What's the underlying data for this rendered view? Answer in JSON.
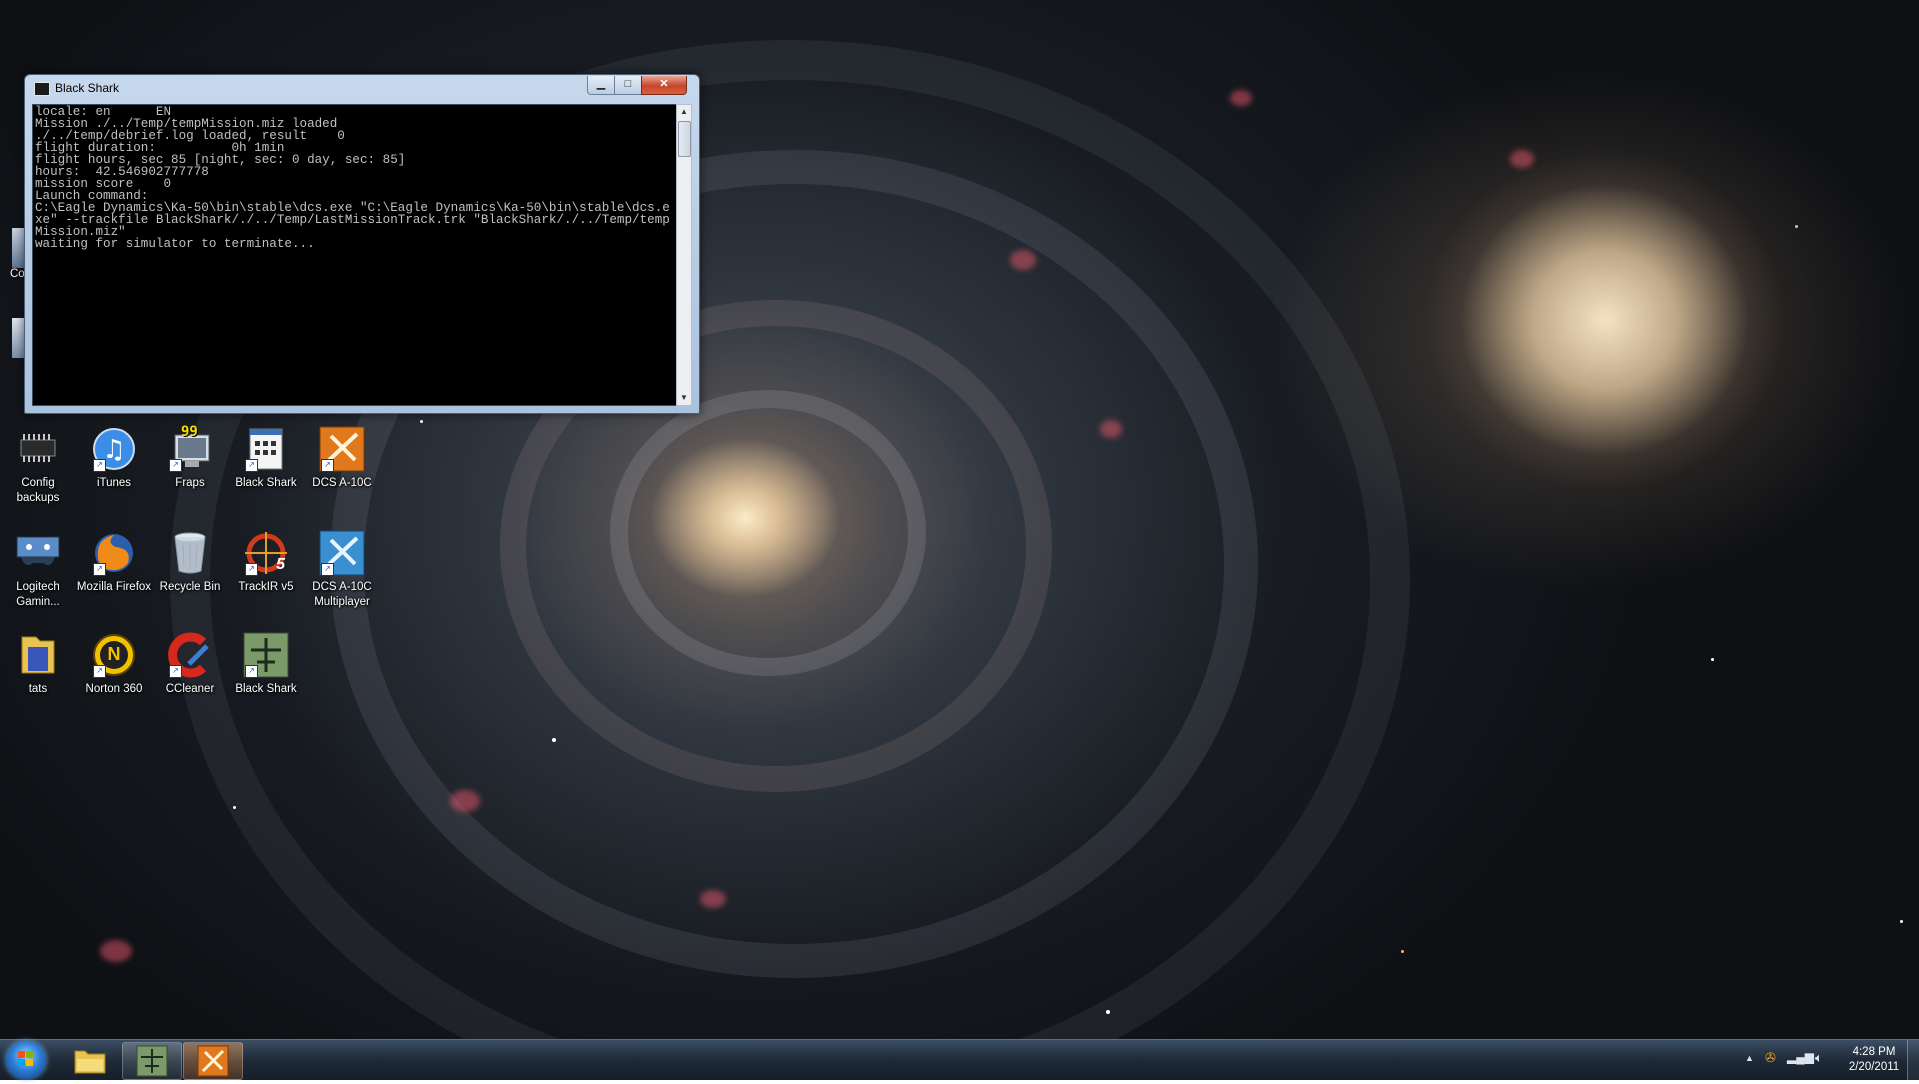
{
  "console_window": {
    "title": "Black Shark",
    "minimize_glyph": "▁",
    "maximize_glyph": "□",
    "close_glyph": "✕",
    "lines": [
      "locale: en      EN",
      "Mission ./../Temp/tempMission.miz loaded",
      "./../temp/debrief.log loaded, result    0",
      "flight duration:          0h 1min",
      "flight hours, sec 85 [night, sec: 0 day, sec: 85]",
      "hours:  42.546902777778",
      "mission score    0",
      "Launch command:",
      "C:\\Eagle Dynamics\\Ka-50\\bin\\stable\\dcs.exe \"C:\\Eagle Dynamics\\Ka-50\\bin\\stable\\dcs.exe\" --trackfile BlackShark/./../Temp/LastMissionTrack.trk \"BlackShark/./../Temp/tempMission.miz\"",
      "waiting for simulator to terminate..."
    ]
  },
  "desktop_icons": [
    {
      "label": "Config backups",
      "icon": "chip-icon"
    },
    {
      "label": "iTunes",
      "icon": "itunes-icon"
    },
    {
      "label": "Fraps",
      "icon": "fraps-icon",
      "badge": "99"
    },
    {
      "label": "Black Shark",
      "icon": "launcher-icon"
    },
    {
      "label": "DCS A-10C",
      "icon": "dcs-a10c-icon"
    },
    {
      "label": "Logitech Gamin...",
      "icon": "gamepad-icon"
    },
    {
      "label": "Mozilla Firefox",
      "icon": "firefox-icon"
    },
    {
      "label": "Recycle Bin",
      "icon": "recycle-bin-icon"
    },
    {
      "label": "TrackIR v5",
      "icon": "trackir-icon",
      "badge": "5"
    },
    {
      "label": "DCS A-10C Multiplayer",
      "icon": "dcs-a10c-multiplayer-icon"
    },
    {
      "label": "tats",
      "icon": "folder-icon"
    },
    {
      "label": "Norton 360",
      "icon": "norton-icon",
      "badge": "N"
    },
    {
      "label": "CCleaner",
      "icon": "ccleaner-icon"
    },
    {
      "label": "Black Shark",
      "icon": "black-shark-icon"
    }
  ],
  "partial_icon_label": "Co",
  "taskbar": {
    "clock_time": "4:28 PM",
    "clock_date": "2/20/2011",
    "tray_arrow": "▲"
  },
  "colors": {
    "console_bg": "#000000",
    "console_text": "#c0c0c0",
    "taskbar": "#1e2a38"
  }
}
